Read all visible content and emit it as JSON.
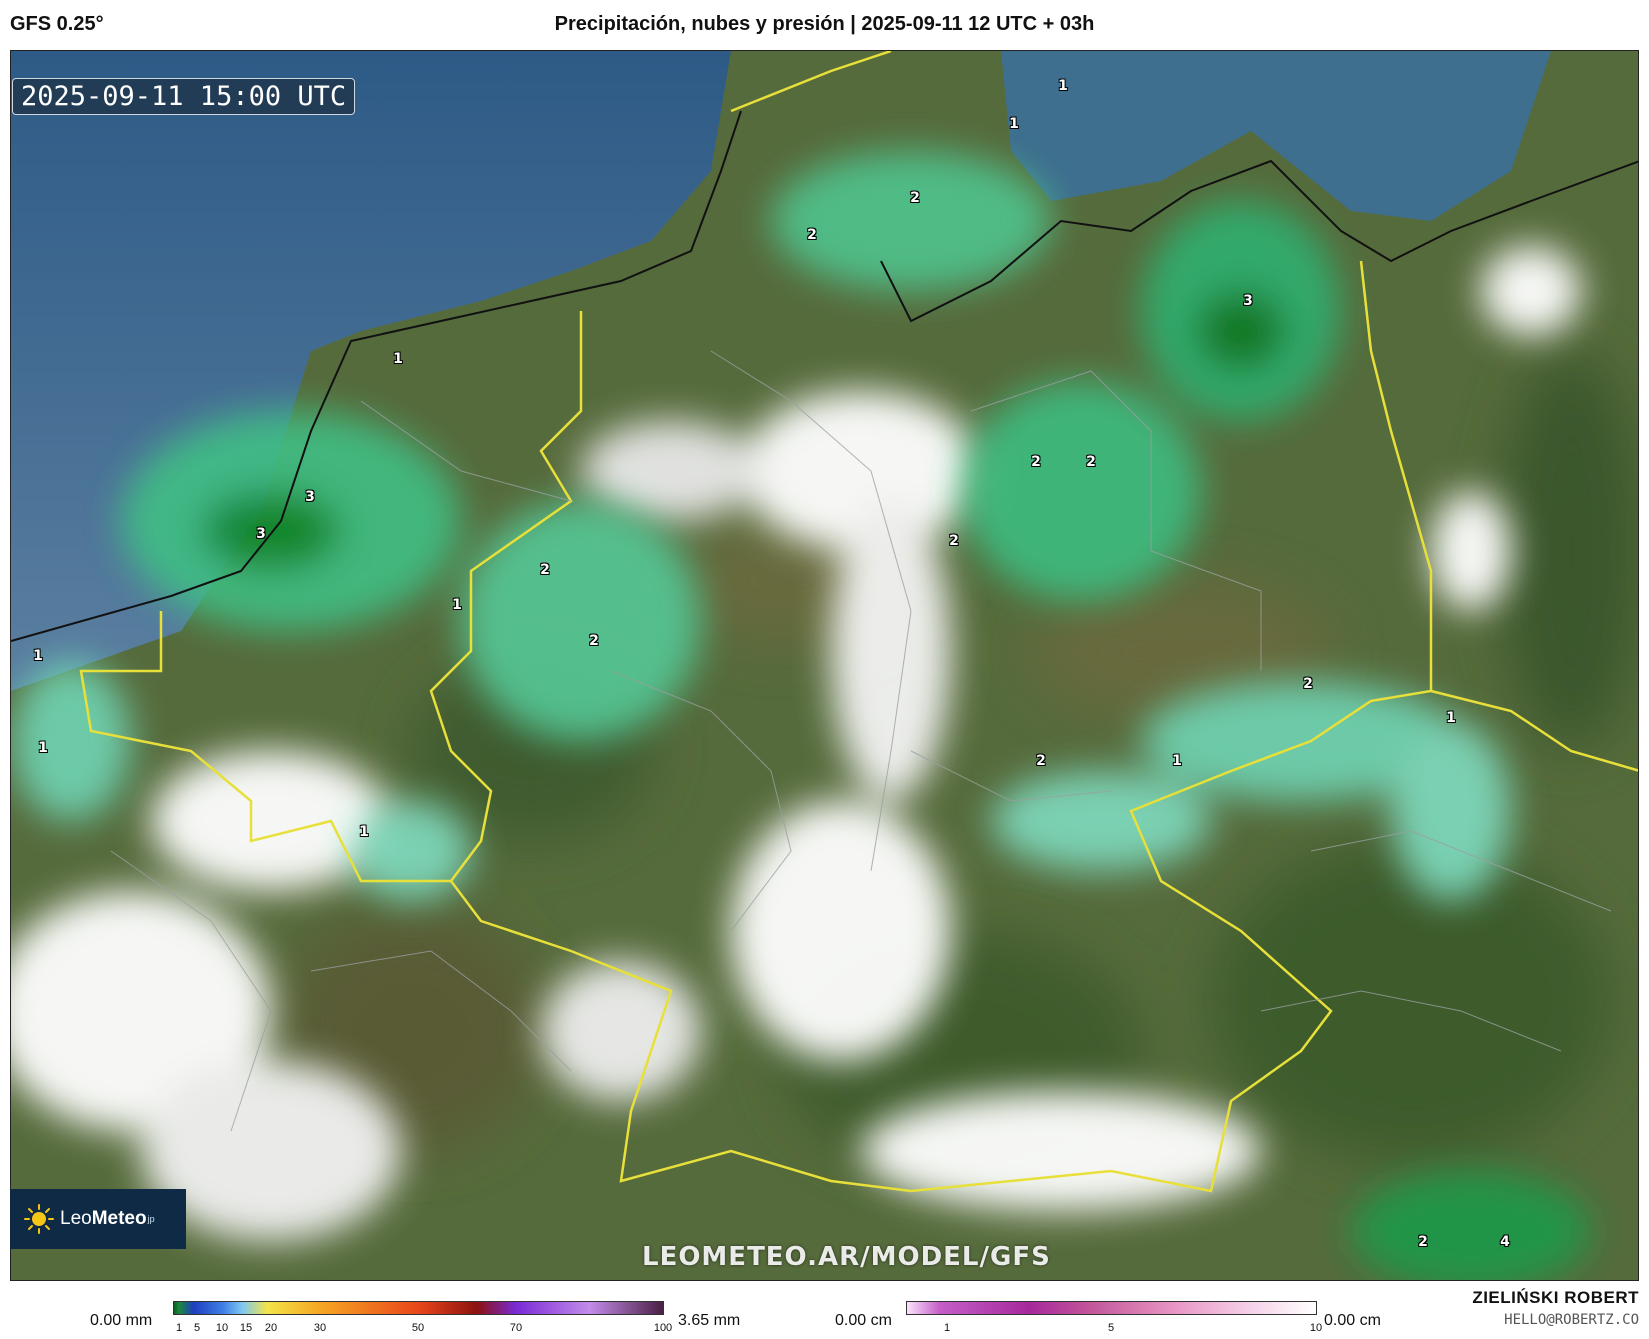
{
  "header": {
    "model": "GFS 0.25°",
    "title": "Precipitación, nubes y presión | 2025-09-11 12 UTC + 03h"
  },
  "map": {
    "timestamp": "2025-09-11 15:00 UTC",
    "watermark": "LEOMETEO.AR/MODEL/GFS",
    "precip_labels": [
      "1",
      "1",
      "1",
      "2",
      "2",
      "3",
      "1",
      "1",
      "2",
      "2",
      "2",
      "2",
      "2",
      "1",
      "3",
      "3",
      "1",
      "2",
      "1",
      "2",
      "1",
      "1",
      "1",
      "1",
      "2",
      "4"
    ]
  },
  "logo": {
    "text_light": "Leo",
    "text_bold": "Meteo",
    "suffix": "jp"
  },
  "legend_precip": {
    "min": "0.00 mm",
    "max": "3.65 mm",
    "ticks": [
      "1",
      "5",
      "10",
      "15",
      "20",
      "30",
      "50",
      "70",
      "100"
    ]
  },
  "legend_snow": {
    "min": "0.00 cm",
    "max": "0.00 cm",
    "ticks": [
      "1",
      "5",
      "10"
    ]
  },
  "credits": {
    "author": "ZIELIŃSKI ROBERT",
    "email": "HELLO@ROBERTZ.CO"
  },
  "colors": {
    "sea": "#2f5f8a",
    "land": "#5b6d3c",
    "precip_light": "#6fd4b4",
    "precip_heavy": "#0a7a1e",
    "cloud": "#ffffff",
    "border_national": "#e8e03a",
    "logo_bg": "#0f2a44"
  }
}
